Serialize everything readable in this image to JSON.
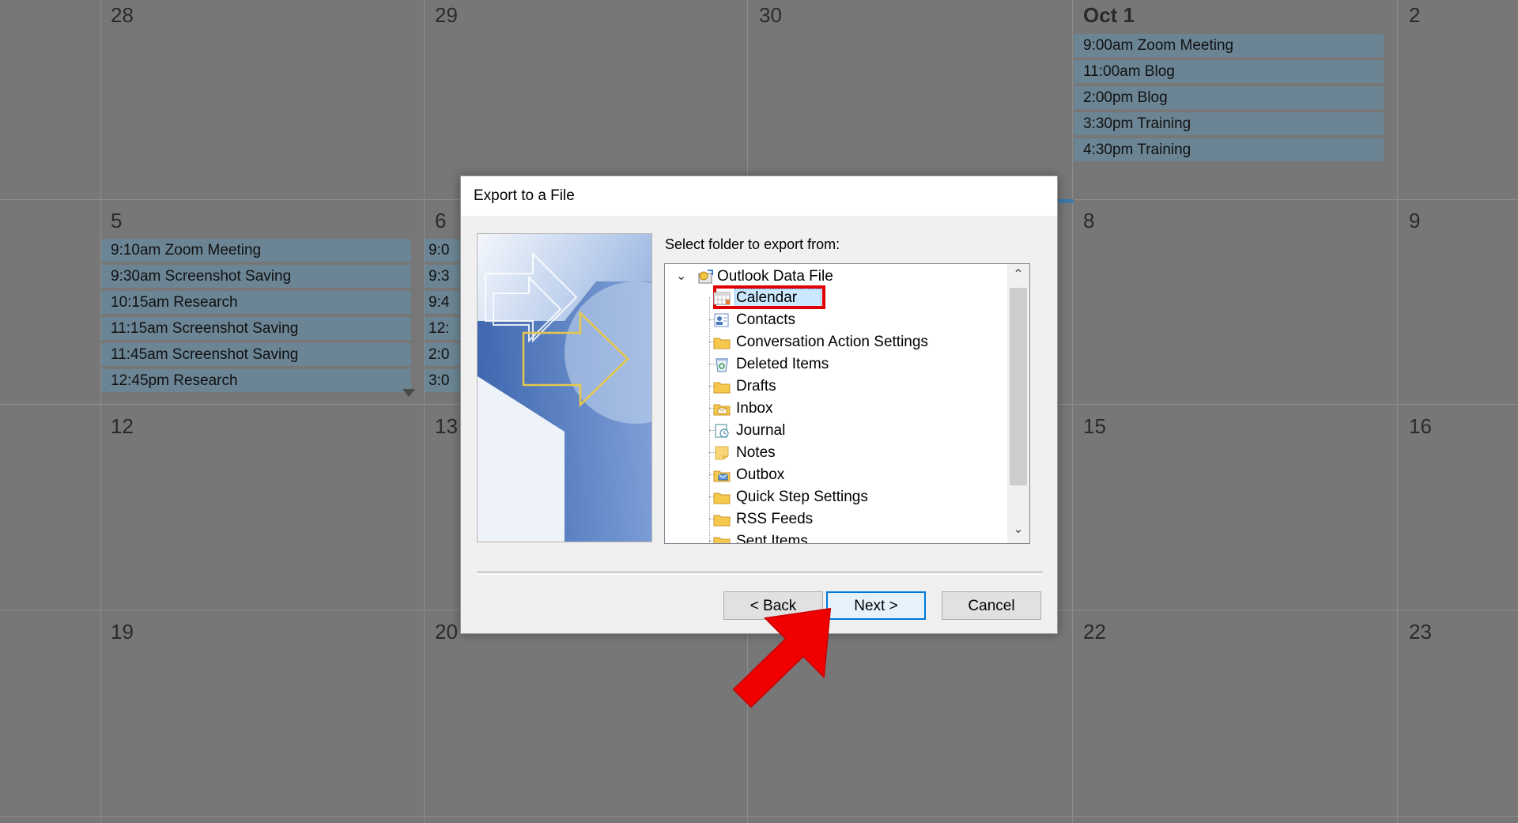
{
  "calendar": {
    "week1": {
      "days": [
        "28",
        "29",
        "30",
        "Oct 1",
        "2"
      ],
      "oct1_events": [
        "9:00am Zoom Meeting",
        "11:00am Blog",
        "2:00pm Blog",
        "3:30pm Training",
        "4:30pm Training"
      ]
    },
    "week2": {
      "days": [
        "5",
        "6",
        "8",
        "9"
      ],
      "day5_events": [
        "9:10am Zoom Meeting",
        "9:30am Screenshot Saving",
        "10:15am Research",
        "11:15am Screenshot Saving",
        "11:45am Screenshot Saving",
        "12:45pm Research"
      ],
      "day6_events_partial": [
        "9:0",
        "9:3",
        "9:4",
        "12:",
        "2:0",
        "3:0"
      ]
    },
    "week3": {
      "days": [
        "12",
        "13",
        "15",
        "16"
      ]
    },
    "week4": {
      "days": [
        "19",
        "20",
        "22",
        "23"
      ]
    }
  },
  "dialog": {
    "title": "Export to a File",
    "folder_label": "Select folder to export from:",
    "tree": {
      "root": "Outlook Data File",
      "items": [
        {
          "label": "Calendar",
          "icon": "calendar-icon",
          "selected": true
        },
        {
          "label": "Contacts",
          "icon": "contacts-icon"
        },
        {
          "label": "Conversation Action Settings",
          "icon": "folder-icon"
        },
        {
          "label": "Deleted Items",
          "icon": "recycle-icon"
        },
        {
          "label": "Drafts",
          "icon": "folder-icon"
        },
        {
          "label": "Inbox",
          "icon": "inbox-icon"
        },
        {
          "label": "Journal",
          "icon": "journal-icon"
        },
        {
          "label": "Notes",
          "icon": "notes-icon"
        },
        {
          "label": "Outbox",
          "icon": "outbox-icon"
        },
        {
          "label": "Quick Step Settings",
          "icon": "folder-icon"
        },
        {
          "label": "RSS Feeds",
          "icon": "folder-icon"
        },
        {
          "label": "Sent Items",
          "icon": "folder-icon"
        }
      ]
    },
    "buttons": {
      "back": "< Back",
      "next": "Next >",
      "cancel": "Cancel"
    }
  },
  "colors": {
    "overlay_bg": "#777777",
    "event_bg": "#6b8594",
    "highlight_red": "#e00000",
    "selection_blue": "#cce8ff",
    "default_button_border": "#0078d7"
  }
}
